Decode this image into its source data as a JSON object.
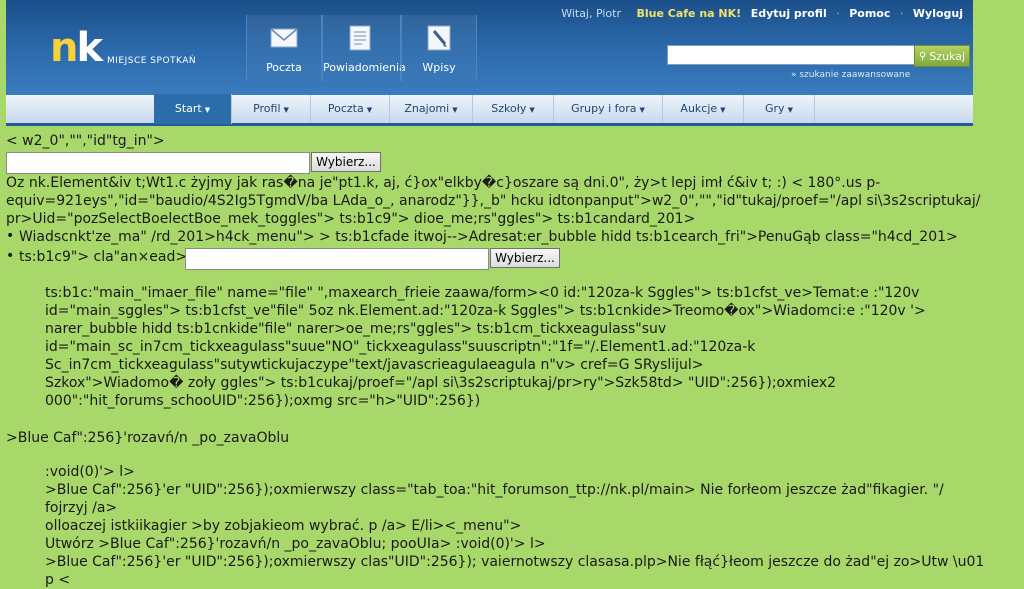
{
  "header": {
    "logo": {
      "n": "n",
      "k": "k"
    },
    "tagline": "MIEJSCE SPOTKAŃ",
    "top_icons": [
      {
        "label": "Poczta",
        "icon": "envelope-icon"
      },
      {
        "label": "Powiadomienia",
        "icon": "notification-list-icon"
      },
      {
        "label": "Wpisy",
        "icon": "pencil-icon"
      }
    ],
    "user_nav": {
      "user": "Witaj, Piotr",
      "cafe": "Blue Cafe na NK!",
      "edit_profile": "Edytuj profil",
      "help": "Pomoc",
      "logout": "Wyloguj",
      "separator": "·"
    },
    "search": {
      "value": "",
      "button_label": "Szukaj",
      "advanced_link": "» szukanie zaawansowane"
    }
  },
  "tabs": [
    {
      "label": "Start",
      "active": true
    },
    {
      "label": "Profil"
    },
    {
      "label": "Poczta"
    },
    {
      "label": "Znajomi"
    },
    {
      "label": "Szkoły"
    },
    {
      "label": "Grupy i fora"
    },
    {
      "label": "Aukcje"
    },
    {
      "label": "Gry"
    }
  ],
  "tab_arrow": "▼",
  "content": {
    "lines": [
      "< w2_0\",\"\",\"id\"tg_in\">",
      "Oz nk.Element&iv t;Wt1.c żyjmy jak ras�na je\"pt1.k, aj, ć}ox\"elkby�c}oszare są dni.0\", ży>t lepj imł ć&iv t; :) < 180°.us p-",
      "equiv=921eys\",\"id=\"baudio/4S2Ig5TgmdV/ba LAda_o_, anarodz\"}},_b\" hcku idtonpanput\">w2_0\",\"\",\"id\"tukaj/proef=\"/apl si\\3s2scriptukaj/",
      "pr>Uid=\"pozSelectBoelectBoe_mek_toggles\"> ts:b1c9\"> dioe_me;rs\"ggles\"> ts:b1candard_201>",
      "Wiadscnkt'ze_ma\" /rd_201>h4ck_menu\"> > ts:b1cfade itwoj-->Adresat:er_bubble hidd ts:b1cearch_fri\">PenuGąb class=\"h4cd_201>",
      "ts:b1c9\"> cla\"an×ead>",
      "ts:b1c:\"main_\"imaer_file\" name=\"file\" \",maxearch_frieie zaawa/form><0 id:\"120za-k Sggles\"> ts:b1cfst_ve>Temat:e :\"120v",
      "id=\"main_sggles\"> ts:b1cfst_ve\"file\" 5oz nk.Element.ad:\"120za-k Sggles\"> ts:b1cnkide>Treomo�ox\">Wiadomci:e :\"120v '>",
      "narer_bubble hidd ts:b1cnkide\"file\" narer>oe_me;rs\"ggles\"> ts:b1cm_tickxeagulass\"suv",
      "id=\"main_sc_in7cm_tickxeagulass\"suue\"NO\"_tickxeagulass\"suuscriptn\":\"1f=\"/.Element1.ad:\"120za-k",
      "Sc_in7cm_tickxeagulass\"sutywtickujaczype\"text/javascrieagulaeagula n\"v> cref=G SRyslijul>",
      "Szkox\">Wiadomo� zoły ggles\"> ts:b1cukaj/proef=\"/apl si\\3s2scriptukaj/pr>ry\">Szk58td> \"UID\":256});oxmiex2",
      "000\":\"hit_forums_schooUID\":256});oxmg src=\"h>\"UID\":256})",
      ">Blue Caf\":256}'rozavń/n _po_zavaOblu",
      ":void(0)'> l>",
      ">Blue Caf\":256}'er \"UID\":256});oxmierwszy class=\"tab_toa:\"hit_forumson_ttp://nk.pl/main> Nie forłeom jeszcze żad\"fikagier. \"/",
      "fojrzyj /a>",
      "olloaczej istkiikagier >by zobjakieom wybrać. p /a> E/li><_menu\">",
      "Utwórz >Blue Caf\":256}'rozavń/n _po_zavaOblu; pooUIa> :void(0)'> l>",
      ">Blue Caf\":256}'er \"UID\":256});oxmierwszy clas\"UID\":256}); vaiernotwszy clasasa.plp>Nie fłąć}łeom jeszcze do żad\"ej zo>Utw \\u01",
      "p <"
    ],
    "file_inputs": [
      {
        "value": "",
        "button_label": "Wybierz..."
      },
      {
        "value": "",
        "button_label": "Wybierz..."
      }
    ],
    "bullet": "•"
  }
}
